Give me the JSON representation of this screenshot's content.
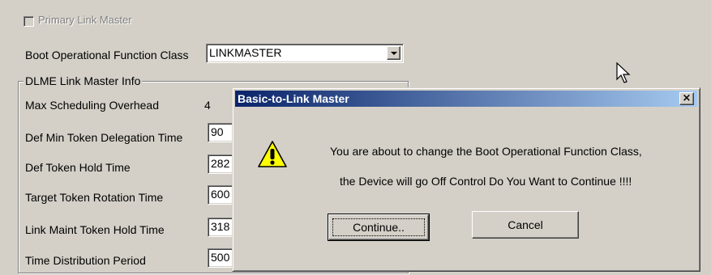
{
  "settings": {
    "primary_link_master_label": "Primary Link Master",
    "boot_class_label": "Boot Operational Function Class",
    "boot_class_value": "LINKMASTER",
    "dlme_group_label": "DLME Link Master Info",
    "rows": [
      {
        "label": "Max Scheduling Overhead",
        "value": "4"
      },
      {
        "label": "Def Min Token Delegation Time",
        "value": "90"
      },
      {
        "label": "Def Token Hold Time",
        "value": "282"
      },
      {
        "label": "Target Token Rotation Time",
        "value": "600"
      },
      {
        "label": "Link Maint Token Hold Time",
        "value": "318"
      },
      {
        "label": "Time Distribution Period",
        "value": "500"
      }
    ]
  },
  "dialog": {
    "title": "Basic-to-Link Master",
    "close_glyph": "×",
    "message_line1": "You are about to change the Boot Operational Function Class,",
    "message_line2": "the Device will go Off Control  Do You Want to Continue !!!!",
    "continue_label": "Continue..",
    "cancel_label": "Cancel",
    "warning_glyph": "!"
  },
  "colors": {
    "face": "#d4d0c8",
    "title_start": "#0a246a",
    "title_end": "#a6caf0",
    "warning_fill": "#ffff00"
  }
}
